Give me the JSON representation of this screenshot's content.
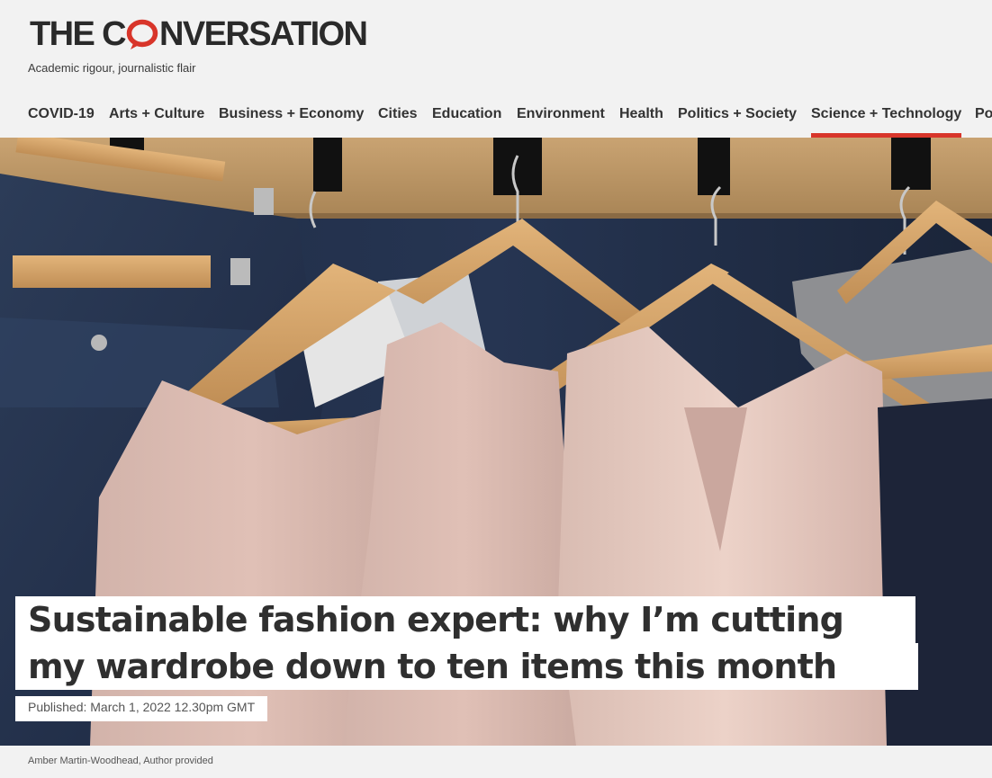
{
  "brand": {
    "logo_part1": "THE C",
    "logo_part2": "NVERSATION",
    "tagline": "Academic rigour, journalistic flair",
    "accent_color": "#d8352a"
  },
  "nav": {
    "items": [
      {
        "label": "COVID-19"
      },
      {
        "label": "Arts + Culture"
      },
      {
        "label": "Business + Economy"
      },
      {
        "label": "Cities"
      },
      {
        "label": "Education"
      },
      {
        "label": "Environment"
      },
      {
        "label": "Health"
      },
      {
        "label": "Politics + Society"
      },
      {
        "label": "Science + Technology",
        "active": true
      },
      {
        "label": "Po"
      }
    ]
  },
  "article": {
    "title_line1": "Sustainable fashion expert: why I’m cutting",
    "title_line2": "my wardrobe down to ten items this month",
    "published": "Published: March 1, 2022 12.30pm GMT",
    "image_credit": "Amber Martin-Woodhead, Author provided"
  },
  "icons": {
    "logo_o": "speech-bubble-icon"
  }
}
